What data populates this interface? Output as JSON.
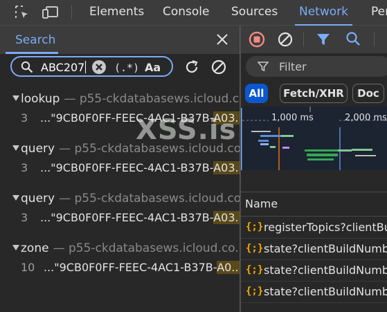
{
  "toolbar": {
    "tabs": [
      {
        "label": "Elements"
      },
      {
        "label": "Console"
      },
      {
        "label": "Sources"
      },
      {
        "label": "Network"
      },
      {
        "label": "Per"
      }
    ]
  },
  "search_panel": {
    "tab_label": "Search",
    "query": "ABC207",
    "regex_label": "(.*)",
    "case_label": "Aa",
    "results": [
      {
        "name": "lookup",
        "url": "— p55-ckdatabasews.icloud.c...",
        "line": "3",
        "text": "...\"9CB0F0FF-FEEC-4AC1-B37B-",
        "match": "A03..."
      },
      {
        "name": "query",
        "url": "— p55-ckdatabasews.icloud.co...",
        "line": "3",
        "text": "...\"9CB0F0FF-FEEC-4AC1-B37B-",
        "match": "A03..."
      },
      {
        "name": "query",
        "url": "— p55-ckdatabasews.icloud.co...",
        "line": "3",
        "text": "...\"9CB0F0FF-FEEC-4AC1-B37B-",
        "match": "A03..."
      },
      {
        "name": "zone",
        "url": "— p55-ckdatabasews.icloud.co...",
        "line": "10",
        "text": "...\"9CB0F0FF-FEEC-4AC1-B37B-",
        "match": "A0..."
      }
    ]
  },
  "network_panel": {
    "filter_placeholder": "Filter",
    "chips": [
      {
        "label": "All"
      },
      {
        "label": "Fetch/XHR"
      },
      {
        "label": "Doc"
      }
    ],
    "timeline_labels": [
      "1,000 ms",
      "2,000 ms"
    ],
    "name_header": "Name",
    "requests": [
      {
        "icon": "{;}",
        "name": "registerTopics?clientBu"
      },
      {
        "icon": "{;}",
        "name": "state?clientBuildNumb"
      },
      {
        "icon": "{;}",
        "name": "state?clientBuildNumb"
      },
      {
        "icon": "{;}",
        "name": "state?clientBuildNumb"
      }
    ]
  },
  "watermark": "XSS.is",
  "colors": {
    "accent": "#7cacf8",
    "record": "#f28b82",
    "highlight": "#5a4a1a",
    "chip_active": "#0b57d0"
  }
}
